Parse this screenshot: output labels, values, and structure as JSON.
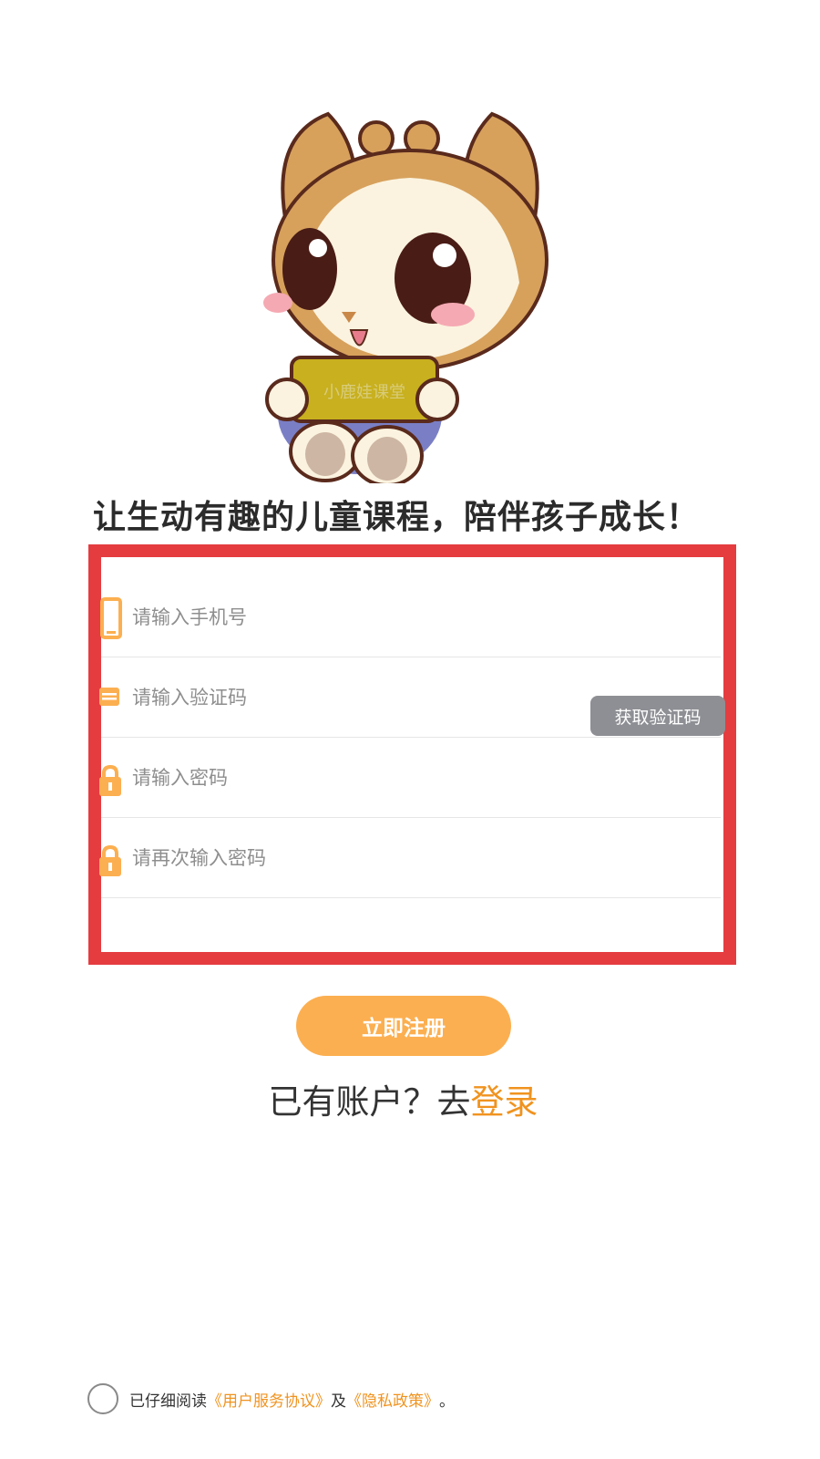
{
  "mascot": {
    "book_text": "小鹿娃课堂"
  },
  "slogan": "让生动有趣的儿童课程，陪伴孩子成长！",
  "form": {
    "phone_placeholder": "请输入手机号",
    "code_placeholder": "请输入验证码",
    "get_code_label": "获取验证码",
    "password_placeholder": "请输入密码",
    "password_confirm_placeholder": "请再次输入密码"
  },
  "register_label": "立即注册",
  "login_prompt": "已有账户？去",
  "login_link": "登录",
  "agreement": {
    "prefix": "已仔细阅读",
    "terms": "《用户服务协议》",
    "and": "及",
    "privacy": "《隐私政策》",
    "suffix": "。"
  },
  "colors": {
    "accent": "#fcaf50",
    "link": "#f0931f",
    "highlight_border": "#e53c40",
    "code_button": "#8e8f94"
  }
}
